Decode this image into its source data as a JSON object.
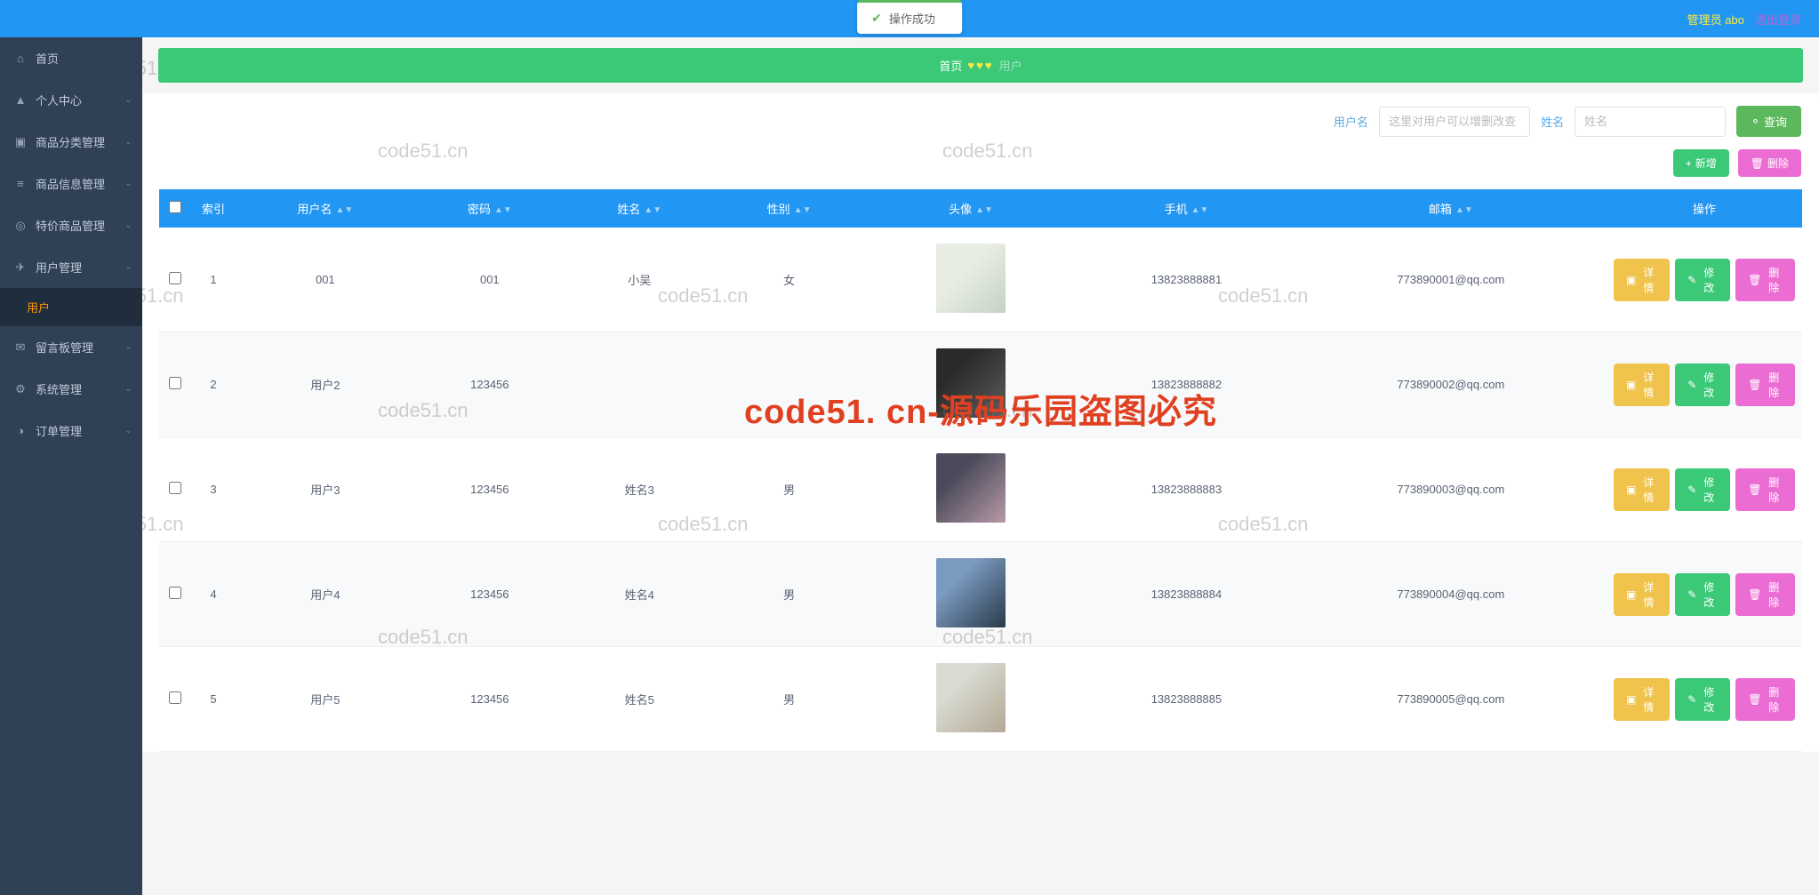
{
  "header": {
    "notif_text": "操作成功",
    "admin_label": "管理员 abo",
    "logout_label": "退出登录"
  },
  "sidebar": {
    "items": [
      {
        "icon": "home",
        "label": "首页"
      },
      {
        "icon": "user",
        "label": "个人中心"
      },
      {
        "icon": "box",
        "label": "商品分类管理"
      },
      {
        "icon": "list",
        "label": "商品信息管理"
      },
      {
        "icon": "tag",
        "label": "特价商品管理"
      },
      {
        "icon": "users",
        "label": "用户管理"
      },
      {
        "icon": "msg",
        "label": "留言板管理"
      },
      {
        "icon": "gear",
        "label": "系统管理"
      },
      {
        "icon": "order",
        "label": "订单管理"
      }
    ],
    "sub_user": "用户"
  },
  "breadcrumb": {
    "home": "首页",
    "current": "用户"
  },
  "search": {
    "username_label": "用户名",
    "username_placeholder": "这里对用户可以增删改查",
    "name_label": "姓名",
    "name_placeholder": "姓名",
    "query_btn": "查询"
  },
  "actions": {
    "add_btn": "新增",
    "delete_btn": "删除"
  },
  "table": {
    "headers": {
      "index": "索引",
      "username": "用户名",
      "password": "密码",
      "name": "姓名",
      "gender": "性别",
      "avatar": "头像",
      "phone": "手机",
      "email": "邮箱",
      "ops": "操作"
    },
    "ops_labels": {
      "detail": "详情",
      "edit": "修改",
      "delete": "删除"
    },
    "rows": [
      {
        "index": "1",
        "username": "001",
        "password": "001",
        "name": "小吴",
        "gender": "女",
        "phone": "13823888881",
        "email": "773890001@qq.com"
      },
      {
        "index": "2",
        "username": "用户2",
        "password": "123456",
        "name": "",
        "gender": "",
        "phone": "13823888882",
        "email": "773890002@qq.com"
      },
      {
        "index": "3",
        "username": "用户3",
        "password": "123456",
        "name": "姓名3",
        "gender": "男",
        "phone": "13823888883",
        "email": "773890003@qq.com"
      },
      {
        "index": "4",
        "username": "用户4",
        "password": "123456",
        "name": "姓名4",
        "gender": "男",
        "phone": "13823888884",
        "email": "773890004@qq.com"
      },
      {
        "index": "5",
        "username": "用户5",
        "password": "123456",
        "name": "姓名5",
        "gender": "男",
        "phone": "13823888885",
        "email": "773890005@qq.com"
      }
    ]
  },
  "watermark": {
    "small": "code51.cn",
    "big": "code51. cn-源码乐园盗图必究"
  }
}
